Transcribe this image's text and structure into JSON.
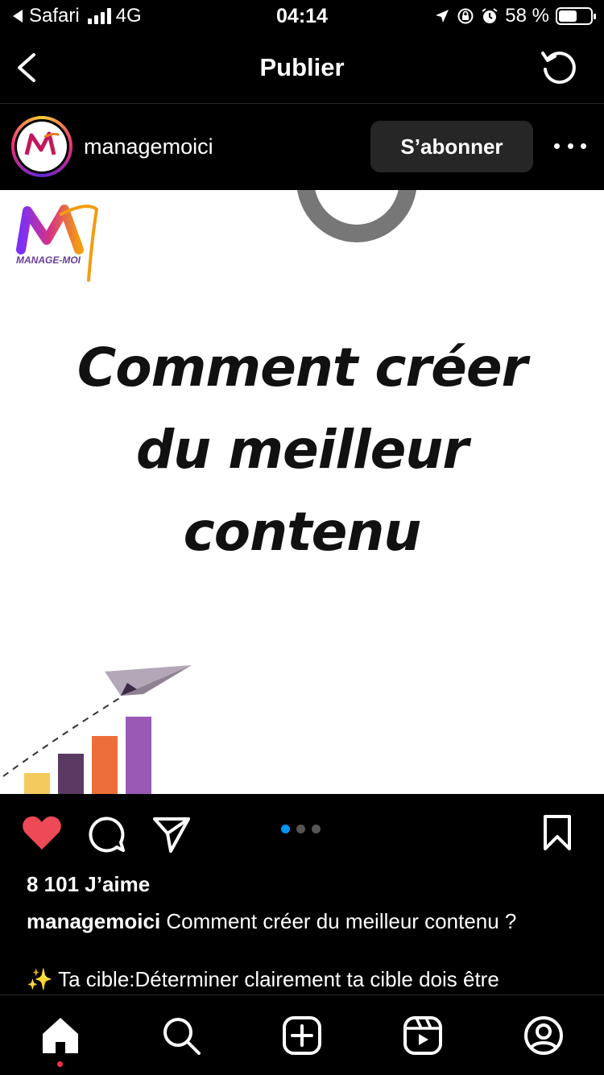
{
  "status_bar": {
    "back_app": "Safari",
    "network": "4G",
    "time": "04:14",
    "battery_percent": "58 %",
    "battery_level": 0.58
  },
  "nav": {
    "title": "Publier"
  },
  "post": {
    "username": "managemoici",
    "follow_label": "S’abonner",
    "image": {
      "heading_lines": [
        "Comment créer",
        "du meilleur",
        "contenu"
      ],
      "brand_text": "MANAGE-MOI"
    },
    "carousel": {
      "count": 3,
      "active_index": 0
    },
    "likes": "8 101 J’aime",
    "caption_user": "managemoici",
    "caption_text": "Comment créer du meilleur contenu ?",
    "caption_line2": "✨ Ta cible:Déterminer clairement ta cible dois être"
  },
  "icons": {
    "like": "heart-filled-icon",
    "comment": "comment-icon",
    "share": "send-icon",
    "save": "bookmark-icon",
    "tabs": [
      "home-icon",
      "search-icon",
      "create-icon",
      "reels-icon",
      "profile-icon"
    ]
  },
  "colors": {
    "like": "#ed4956",
    "carousel_active": "#0095f6",
    "button_bg": "#262626",
    "notification_dot": "#ff3040"
  }
}
